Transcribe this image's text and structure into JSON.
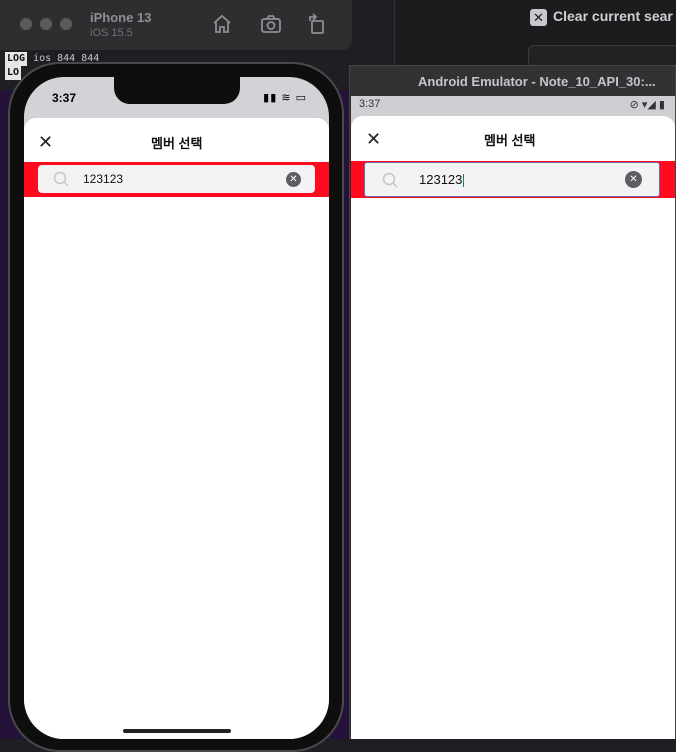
{
  "ios_simulator": {
    "device_name": "iPhone 13",
    "os_version": "iOS 15.5",
    "toolbar_icons": [
      "home-icon",
      "screenshot-icon",
      "rotate-icon"
    ]
  },
  "log": {
    "line1_tag": "LOG",
    "line1_text": "ios 844 844",
    "line2_tag": "LO"
  },
  "right_panel": {
    "clear_search_label": "Clear current sear"
  },
  "ios_screen": {
    "time": "3:37",
    "status": "▮▮ ≋ ▭",
    "sheet_title": "멤버 선택",
    "search_value": "123123"
  },
  "android_emulator": {
    "window_title": "Android Emulator - Note_10_API_30:...",
    "time": "3:37",
    "status": "⊘ ▾◢ ▮",
    "sheet_title": "멤버 선택",
    "search_value": "123123"
  },
  "colors": {
    "search_bar_bg": "#ff0a1e",
    "sheet_bg": "#ffffff"
  }
}
